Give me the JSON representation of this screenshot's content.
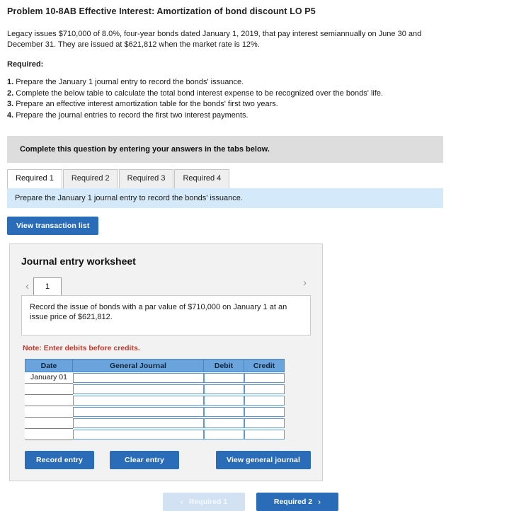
{
  "problem": {
    "title": "Problem 10-8AB Effective Interest: Amortization of bond discount LO P5",
    "intro": "Legacy issues $710,000 of 8.0%, four-year bonds dated January 1, 2019, that pay interest semiannually on June 30 and December 31. They are issued at $621,812 when the market rate is 12%.",
    "required_label": "Required:",
    "requirements": [
      {
        "num": "1.",
        "text": "Prepare the January 1 journal entry to record the bonds' issuance."
      },
      {
        "num": "2.",
        "text": "Complete the below table to calculate the total bond interest expense to be recognized over the bonds' life."
      },
      {
        "num": "3.",
        "text": "Prepare an effective interest amortization table for the bonds' first two years."
      },
      {
        "num": "4.",
        "text": "Prepare the journal entries to record the first two interest payments."
      }
    ]
  },
  "banner": {
    "text": "Complete this question by entering your answers in the tabs below."
  },
  "tabs": [
    {
      "label": "Required 1",
      "active": true
    },
    {
      "label": "Required 2",
      "active": false
    },
    {
      "label": "Required 3",
      "active": false
    },
    {
      "label": "Required 4",
      "active": false
    }
  ],
  "infoband": {
    "text": "Prepare the January 1 journal entry to record the bonds' issuance."
  },
  "toolbar": {
    "view_transaction_list": "View transaction list"
  },
  "worksheet": {
    "title": "Journal entry worksheet",
    "prev_icon": "chevron-left-icon",
    "next_icon": "chevron-right-icon",
    "page_number": "1",
    "description": "Record the issue of bonds with a par value of $710,000 on January 1 at an issue price of $621,812.",
    "note": "Note: Enter debits before credits.",
    "table": {
      "headers": [
        "Date",
        "General Journal",
        "Debit",
        "Credit"
      ],
      "rows": [
        {
          "date": "January 01",
          "general_journal": "",
          "debit": "",
          "credit": ""
        },
        {
          "date": "",
          "general_journal": "",
          "debit": "",
          "credit": ""
        },
        {
          "date": "",
          "general_journal": "",
          "debit": "",
          "credit": ""
        },
        {
          "date": "",
          "general_journal": "",
          "debit": "",
          "credit": ""
        },
        {
          "date": "",
          "general_journal": "",
          "debit": "",
          "credit": ""
        },
        {
          "date": "",
          "general_journal": "",
          "debit": "",
          "credit": ""
        }
      ]
    },
    "actions": {
      "record_entry": "Record entry",
      "clear_entry": "Clear entry",
      "view_general_journal": "View general journal"
    }
  },
  "bottom_nav": {
    "prev_label": "Required 1",
    "next_label": "Required 2",
    "prev_icon": "chevron-left-icon",
    "next_icon": "chevron-right-icon"
  },
  "colors": {
    "accent_blue": "#2b6cb8",
    "table_header_blue": "#6ba4dd",
    "info_band_blue": "#d4eafa",
    "banner_gray": "#dddddd",
    "note_red": "#c0392b"
  }
}
